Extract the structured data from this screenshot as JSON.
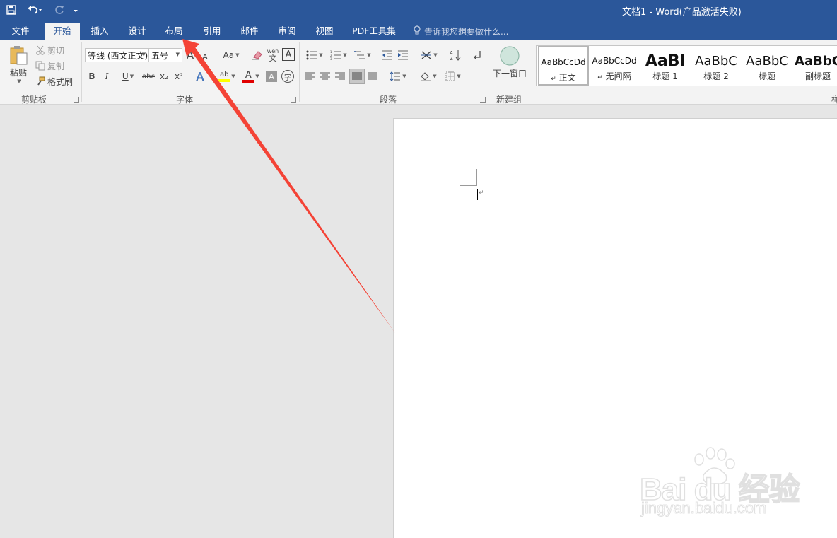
{
  "window": {
    "title": "文档1 - Word(产品激活失败)"
  },
  "quick_access": {
    "save_icon": "save-icon",
    "undo_icon": "undo-icon",
    "redo_icon": "redo-icon",
    "customize_icon": "customize-qat-icon"
  },
  "tabs": [
    {
      "label": "文件",
      "active": false
    },
    {
      "label": "开始",
      "active": true
    },
    {
      "label": "插入",
      "active": false
    },
    {
      "label": "设计",
      "active": false
    },
    {
      "label": "布局",
      "active": false
    },
    {
      "label": "引用",
      "active": false
    },
    {
      "label": "邮件",
      "active": false
    },
    {
      "label": "审阅",
      "active": false
    },
    {
      "label": "视图",
      "active": false
    },
    {
      "label": "PDF工具集",
      "active": false
    }
  ],
  "tell_me": {
    "placeholder": "告诉我您想要做什么..."
  },
  "clipboard": {
    "label": "剪贴板",
    "paste": "粘贴",
    "cut": "剪切",
    "copy": "复制",
    "format_painter": "格式刷"
  },
  "font": {
    "label": "字体",
    "font_name": "等线 (西文正文)",
    "font_size": "五号",
    "change_case": "Aa",
    "bold": "B",
    "italic": "I",
    "underline": "U",
    "strikethrough": "abc",
    "subscript": "x₂",
    "superscript": "x²",
    "phonetic_top": "wén",
    "phonetic_bottom": "文",
    "enclose_char": "字",
    "border_char": "A",
    "shade_char": "A",
    "effects_char": "A",
    "highlight_char": "ab",
    "font_color_char": "A",
    "grow_char": "A",
    "shrink_char": "A"
  },
  "paragraph": {
    "label": "段落"
  },
  "new_group": {
    "label": "新建组",
    "button": "下一窗口"
  },
  "styles": {
    "label": "样",
    "items": [
      {
        "preview": "AaBbCcDd",
        "name": "正文",
        "mark": "↵",
        "selected": true
      },
      {
        "preview": "AaBbCcDd",
        "name": "无间隔",
        "mark": "↵",
        "selected": false
      },
      {
        "preview": "AaBl",
        "name": "标题 1",
        "mark": "",
        "selected": false
      },
      {
        "preview": "AaBbC",
        "name": "标题 2",
        "mark": "",
        "selected": false
      },
      {
        "preview": "AaBbC",
        "name": "标题",
        "mark": "",
        "selected": false
      },
      {
        "preview": "AaBbC",
        "name": "副标题",
        "mark": "",
        "selected": false
      }
    ]
  },
  "document": {
    "paragraph_mark": "↵"
  },
  "annotation": {
    "color": "#f44336"
  },
  "watermark": {
    "brand": "Bai du 经验",
    "url": "jingyan.baidu.com"
  },
  "colors": {
    "accent": "#2b579a",
    "ribbon_bg": "#f3f3f3",
    "workspace_bg": "#e6e6e6",
    "highlight": "#ffff00",
    "font_color": "#e00000"
  }
}
